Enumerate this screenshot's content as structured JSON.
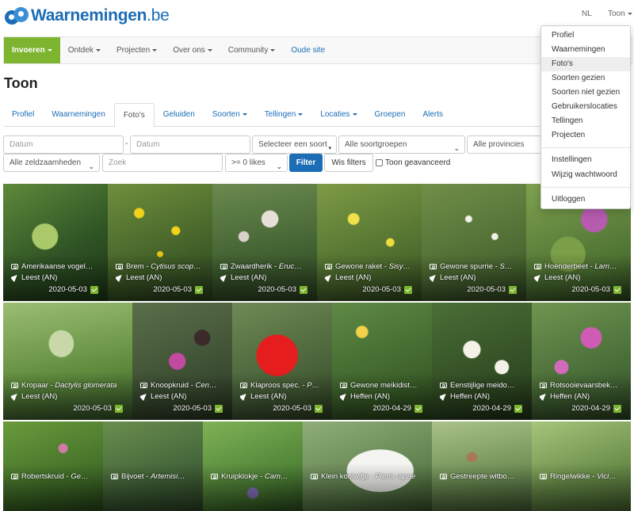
{
  "brand": {
    "name_bold": "Waarnemingen",
    "name_suffix": ".be"
  },
  "topbar": {
    "language": "NL",
    "user": "Toon"
  },
  "nav": {
    "items": [
      {
        "label": "Invoeren",
        "dropdown": true,
        "active": true
      },
      {
        "label": "Ontdek",
        "dropdown": true
      },
      {
        "label": "Projecten",
        "dropdown": true
      },
      {
        "label": "Over ons",
        "dropdown": true
      },
      {
        "label": "Community",
        "dropdown": true
      },
      {
        "label": "Oude site",
        "dropdown": false,
        "link": true
      }
    ]
  },
  "page": {
    "title": "Toon"
  },
  "tabs": [
    {
      "label": "Profiel",
      "dropdown": false
    },
    {
      "label": "Waarnemingen",
      "dropdown": false
    },
    {
      "label": "Foto's",
      "dropdown": false,
      "active": true
    },
    {
      "label": "Geluiden",
      "dropdown": false
    },
    {
      "label": "Soorten",
      "dropdown": true
    },
    {
      "label": "Tellingen",
      "dropdown": true
    },
    {
      "label": "Locaties",
      "dropdown": true
    },
    {
      "label": "Groepen",
      "dropdown": false
    },
    {
      "label": "Alerts",
      "dropdown": false
    }
  ],
  "filters": {
    "date_from_placeholder": "Datum",
    "date_to_placeholder": "Datum",
    "date_separator": "-",
    "species_select": "Selecteer een soort",
    "species_group": "Alle soortgroepen",
    "province": "Alle provincies",
    "rarity": "Alle zeldzaamheden",
    "search_placeholder": "Zoek",
    "likes": ">= 0 likes",
    "filter_button": "Filter",
    "clear_button": "Wis filters",
    "advanced_label": "Toon geavanceerd"
  },
  "user_menu": {
    "group1": [
      "Profiel",
      "Waarnemingen",
      "Foto's",
      "Soorten gezien",
      "Soorten niet gezien",
      "Gebruikerslocaties",
      "Tellingen",
      "Projecten"
    ],
    "group2": [
      "Instellingen",
      "Wijzig wachtwoord"
    ],
    "group3": [
      "Uitloggen"
    ],
    "highlighted": "Foto's"
  },
  "photos": [
    {
      "name": "Amerikaanse vogel…",
      "sci": "",
      "location": "Leest (AN)",
      "date": "2020-05-03"
    },
    {
      "name": "Brem",
      "sci": "Cytisus scop…",
      "location": "Leest (AN)",
      "date": "2020-05-03"
    },
    {
      "name": "Zwaardherik",
      "sci": "Eruc…",
      "location": "Leest (AN)",
      "date": "2020-05-03"
    },
    {
      "name": "Gewone raket",
      "sci": "Sisy…",
      "location": "Leest (AN)",
      "date": "2020-05-03"
    },
    {
      "name": "Gewone spurrie",
      "sci": "S…",
      "location": "Leest (AN)",
      "date": "2020-05-03"
    },
    {
      "name": "Hoenderbeet",
      "sci": "Lam…",
      "location": "Leest (AN)",
      "date": "2020-05-03"
    },
    {
      "name": "Kropaar",
      "sci": "Dactylis glomerata",
      "location": "Leest (AN)",
      "date": "2020-05-03"
    },
    {
      "name": "Knoopkruid",
      "sci": "Cen…",
      "location": "Leest (AN)",
      "date": "2020-05-03"
    },
    {
      "name": "Klaproos spec.",
      "sci": "P…",
      "location": "Leest (AN)",
      "date": "2020-05-03"
    },
    {
      "name": "Gewone meikidist…",
      "sci": "",
      "location": "Heffen (AN)",
      "date": "2020-04-29"
    },
    {
      "name": "Eenstijlige meido…",
      "sci": "",
      "location": "Heffen (AN)",
      "date": "2020-04-29"
    },
    {
      "name": "Rotsooievaarsbek…",
      "sci": "",
      "location": "Heffen (AN)",
      "date": "2020-04-29"
    },
    {
      "name": "Robertskruid",
      "sci": "Ge…",
      "location": "",
      "date": ""
    },
    {
      "name": "Bijvoet",
      "sci": "Artemisi…",
      "location": "",
      "date": ""
    },
    {
      "name": "Kruipklokje",
      "sci": "Cam…",
      "location": "",
      "date": ""
    },
    {
      "name": "Klein koolwitje",
      "sci": "Pieris rapae",
      "location": "",
      "date": ""
    },
    {
      "name": "Gestreepte witbo…",
      "sci": "",
      "location": "",
      "date": ""
    },
    {
      "name": "Ringelwikke",
      "sci": "Vici…",
      "location": "",
      "date": ""
    }
  ],
  "colors": {
    "brand_blue": "#1b6db6",
    "nav_active": "#7db430",
    "verified": "#7db430"
  }
}
